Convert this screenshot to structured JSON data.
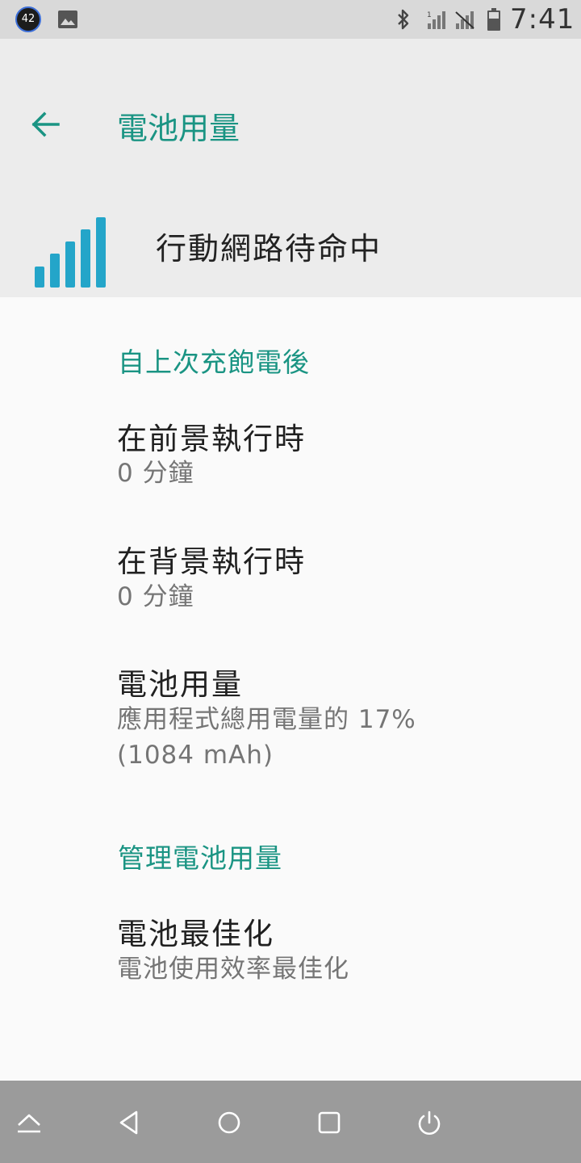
{
  "status_bar": {
    "notification_badge": "42",
    "time": "7:41",
    "icons": [
      "notification-badge",
      "image-icon",
      "bluetooth-icon",
      "signal-icon",
      "signal-no-data-icon",
      "battery-icon"
    ]
  },
  "header": {
    "title": "電池用量",
    "entity_name": "行動網路待命中",
    "accent_color": "#1a9483",
    "signal_color": "#24a5c9"
  },
  "sections": {
    "since_charge": {
      "header": "自上次充飽電後",
      "foreground_title": "在前景執行時",
      "foreground_value": "0 分鐘",
      "background_title": "在背景執行時",
      "background_value": "0 分鐘",
      "usage_title": "電池用量",
      "usage_line1": "應用程式總用電量的 17%",
      "usage_line2": "(1084 mAh)"
    },
    "manage": {
      "header": "管理電池用量",
      "optimization_title": "電池最佳化",
      "optimization_summary": "電池使用效率最佳化"
    }
  },
  "nav_bar": {
    "icons": [
      "collapse-icon",
      "back-icon",
      "home-icon",
      "recents-icon",
      "power-icon"
    ]
  }
}
